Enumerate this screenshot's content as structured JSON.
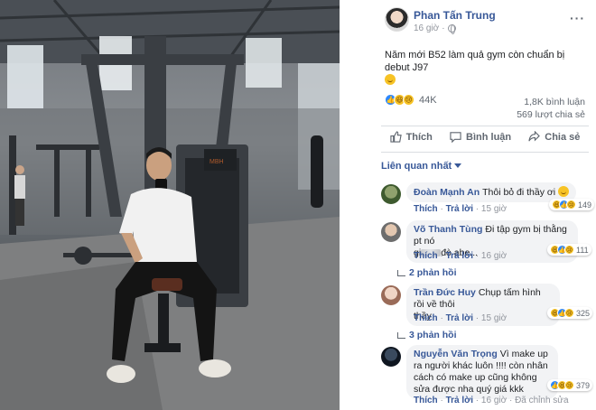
{
  "post": {
    "author": "Phan Tấn Trung",
    "time": "16 giờ",
    "caption": "Năm mới B52 làm quả gym còn chuẩn bị debut J97",
    "reaction_count": "44K",
    "comments_count": "1,8K bình luận",
    "shares_count": "569 lượt chia sẻ"
  },
  "actions": {
    "like": "Thích",
    "comment": "Bình luận",
    "share": "Chia sẻ"
  },
  "filter": {
    "label": "Liên quan nhất"
  },
  "comments": [
    {
      "name": "Đoàn Mạnh An",
      "text": "Thôi bỏ đi thầy ơi",
      "like": "Thích",
      "reply": "Trả lời",
      "time": "15 giờ",
      "reactions": "149"
    },
    {
      "name": "Võ Thanh Tùng",
      "text_line1": "Đi tập gym bị thằng pt nó",
      "text_line2_prefix": "gi",
      "text_line2_suffix": "đò abe...",
      "like": "Thích",
      "reply": "Trả lời",
      "time": "16 giờ",
      "reactions": "111",
      "replies": "2 phản hồi"
    },
    {
      "name": "Trần Đức Huy",
      "text_line1": "Chụp tấm hình rồi về thôi",
      "text_line2": "thầy",
      "like": "Thích",
      "reply": "Trả lời",
      "time": "15 giờ",
      "reactions": "325",
      "replies": "3 phản hồi"
    },
    {
      "name": "Nguyễn Văn Trọng",
      "text_line1_suffix": "Vì make up",
      "text_line2": "ra người khác luôn !!!! còn nhân",
      "text_line3": "cách có make up cũng không",
      "text_line4": "sửa được nha quý giá kkk",
      "like": "Thích",
      "reply": "Trả lời",
      "time": "16 giờ",
      "edited": "Đã chỉnh sửa",
      "reactions": "379"
    }
  ],
  "colors": {
    "link": "#385898",
    "secondary": "#606770",
    "bubble": "#f2f3f5",
    "like_blue": "#2d88ff"
  }
}
